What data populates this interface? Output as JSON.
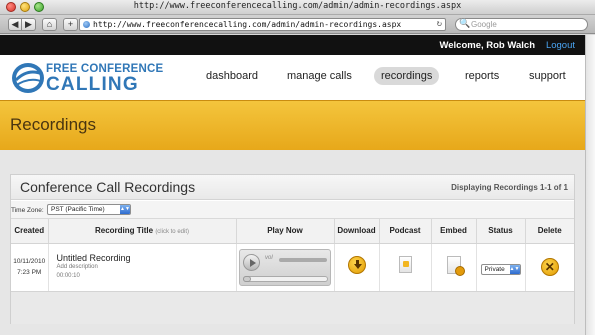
{
  "browser": {
    "window_title": "http://www.freeconferencecalling.com/admin/admin-recordings.aspx",
    "url": "http://www.freeconferencecalling.com/admin/admin-recordings.aspx",
    "search_placeholder": "Google",
    "back_glyph": "◀",
    "forward_glyph": "▶",
    "home_glyph": "⌂",
    "plus_glyph": "+",
    "reload_glyph": "↻",
    "search_glyph": "🔍"
  },
  "site": {
    "welcome": "Welcome, Rob Walch",
    "logout": "Logout",
    "logo_top": "FREE CONFERENCE",
    "logo_bottom": "CALLING",
    "brand_color": "#3077b7",
    "nav": [
      "dashboard",
      "manage calls",
      "recordings",
      "reports",
      "support"
    ],
    "active_nav": "recordings"
  },
  "banner": {
    "title": "Recordings",
    "color": "#f0b628"
  },
  "panel": {
    "title": "Conference Call Recordings",
    "count_text": "Displaying Recordings 1-1 of 1",
    "timezone_label": "Time Zone:",
    "timezone_value": "PST (Pacific Time)"
  },
  "table": {
    "headers": {
      "created": "Created",
      "title": "Recording Title",
      "title_hint": "(click to edit)",
      "play": "Play Now",
      "download": "Download",
      "podcast": "Podcast",
      "embed": "Embed",
      "status": "Status",
      "delete": "Delete"
    },
    "rows": [
      {
        "date": "10/11/2010",
        "time": "7:23 PM",
        "title": "Untitled Recording",
        "description": "Add description",
        "duration": "00:00:10",
        "player_vol_label": "vol",
        "status": "Private",
        "delete_glyph": "✕"
      }
    ]
  }
}
